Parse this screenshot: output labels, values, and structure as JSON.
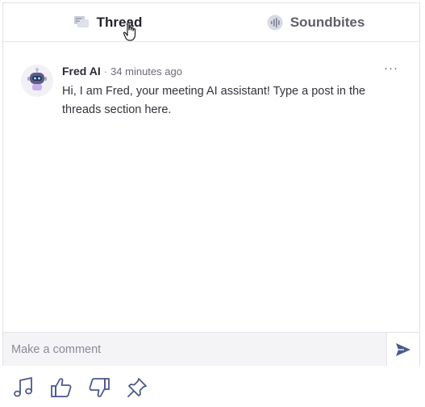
{
  "tabs": [
    {
      "label": "Thread",
      "icon": "chat-bubbles-icon",
      "active": true
    },
    {
      "label": "Soundbites",
      "icon": "audio-wave-icon",
      "active": false
    }
  ],
  "message": {
    "author": "Fred AI",
    "separator": "·",
    "time": "34 minutes ago",
    "text": "Hi, I am Fred, your meeting AI assistant! Type a post in the threads section here.",
    "more_label": "···",
    "avatar_icon": "robot-avatar-icon"
  },
  "composer": {
    "placeholder": "Make a comment",
    "value": "",
    "send_icon": "send-icon"
  },
  "reactions": [
    {
      "icon": "music-note-icon"
    },
    {
      "icon": "thumbs-up-icon"
    },
    {
      "icon": "thumbs-down-icon"
    },
    {
      "icon": "pin-icon"
    }
  ],
  "colors": {
    "icon_accent": "#4a5a8e",
    "tab_active": "#24242e",
    "tab_inactive": "#5f5f6b"
  }
}
